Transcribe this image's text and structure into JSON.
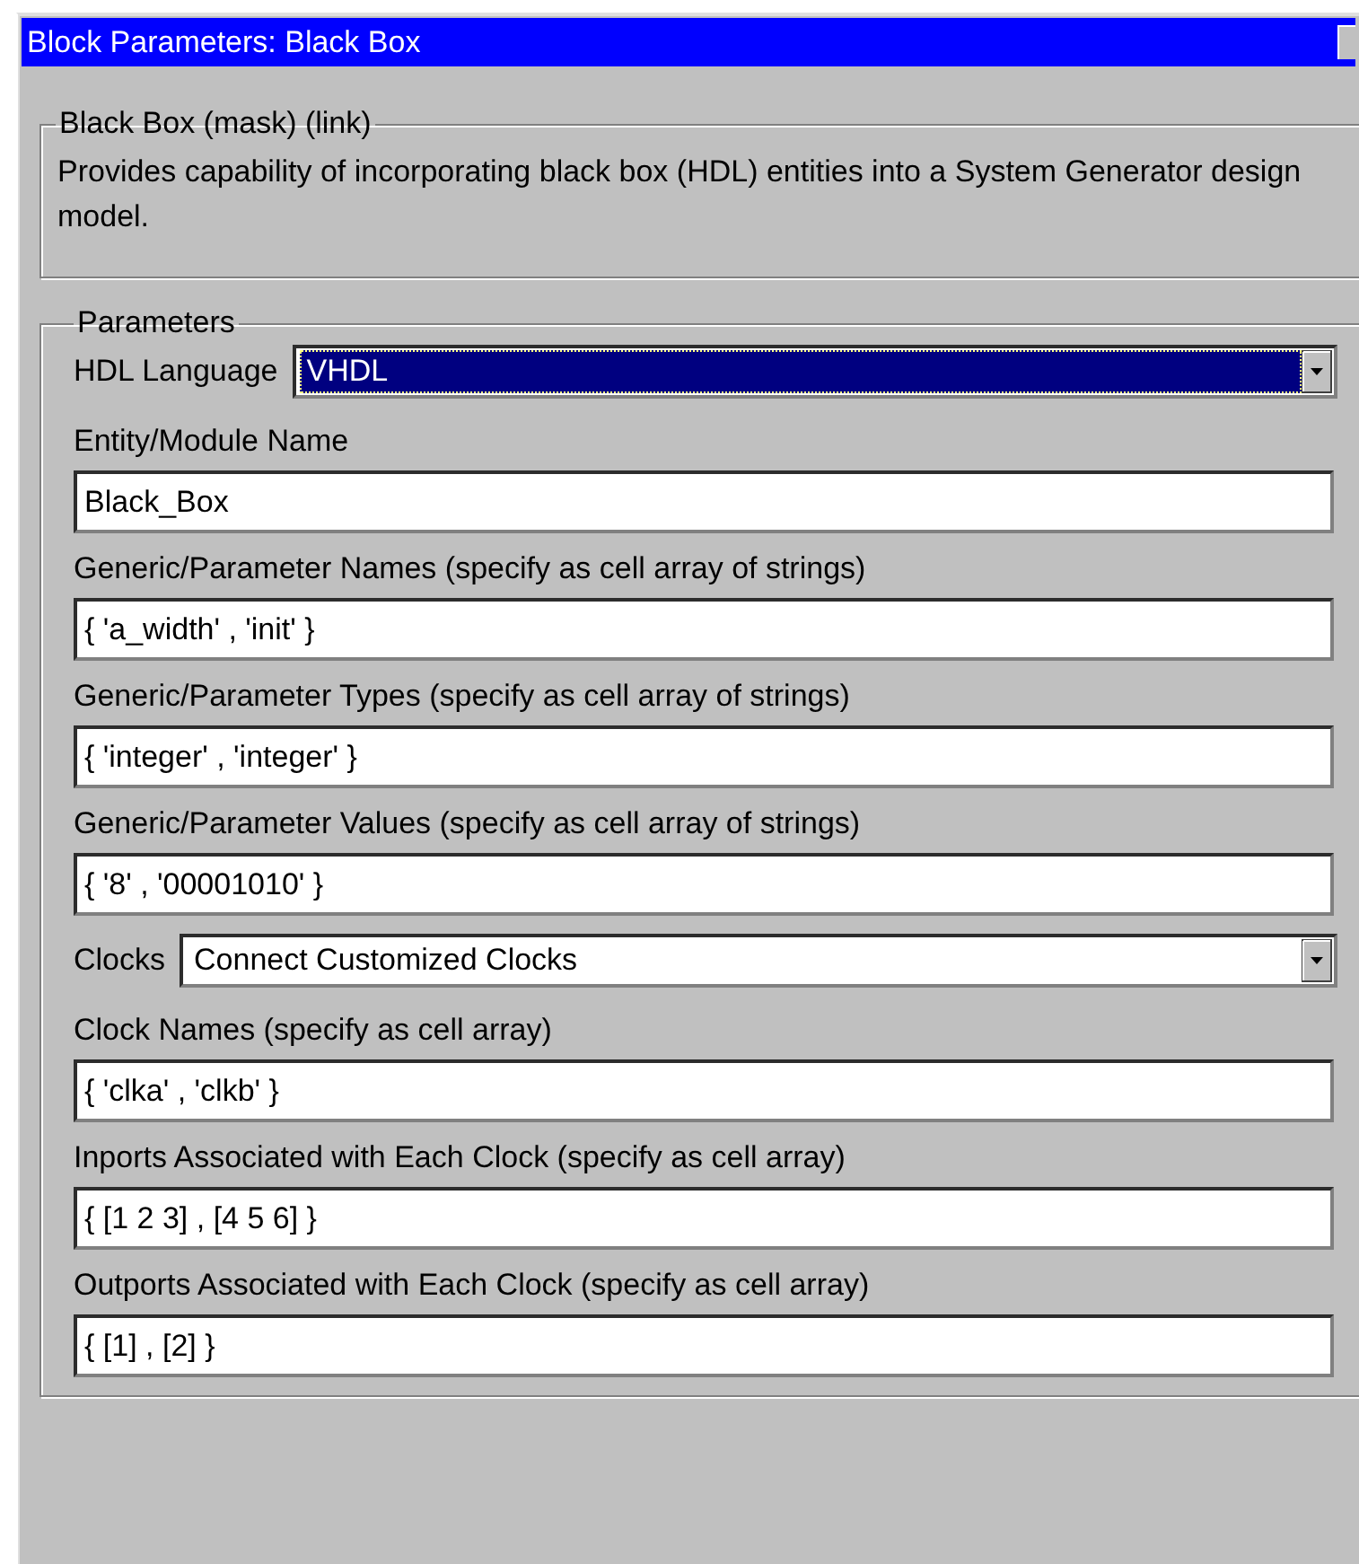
{
  "window": {
    "title": "Block Parameters: Black Box"
  },
  "description_group": {
    "title": "Black Box (mask) (link)",
    "text": "Provides capability of incorporating black box (HDL) entities into a System Generator design model."
  },
  "parameters_group": {
    "title": "Parameters",
    "fields": [
      {
        "kind": "dropdown",
        "label": "HDL Language",
        "value": "VHDL",
        "focused": true
      },
      {
        "kind": "text",
        "label": "Entity/Module Name",
        "value": "Black_Box"
      },
      {
        "kind": "text",
        "label": "Generic/Parameter Names  (specify as cell array of strings)",
        "value": "{ 'a_width' , 'init' }"
      },
      {
        "kind": "text",
        "label": "Generic/Parameter Types  (specify as cell array of strings)",
        "value": "{ 'integer' , 'integer' }"
      },
      {
        "kind": "text",
        "label": "Generic/Parameter Values  (specify as cell array of strings)",
        "value": "{ '8' , '00001010' }"
      },
      {
        "kind": "dropdown",
        "label": "Clocks",
        "value": "Connect Customized Clocks",
        "focused": false
      },
      {
        "kind": "text",
        "label": "Clock Names  (specify as cell array)",
        "value": "{ 'clka' , 'clkb' }"
      },
      {
        "kind": "text",
        "label": "Inports Associated with Each Clock  (specify as cell array)",
        "value": "{ [1 2 3] , [4 5 6] }"
      },
      {
        "kind": "text",
        "label": "Outports Associated with Each Clock  (specify as cell array)",
        "value": "{ [1] , [2] }"
      }
    ]
  }
}
